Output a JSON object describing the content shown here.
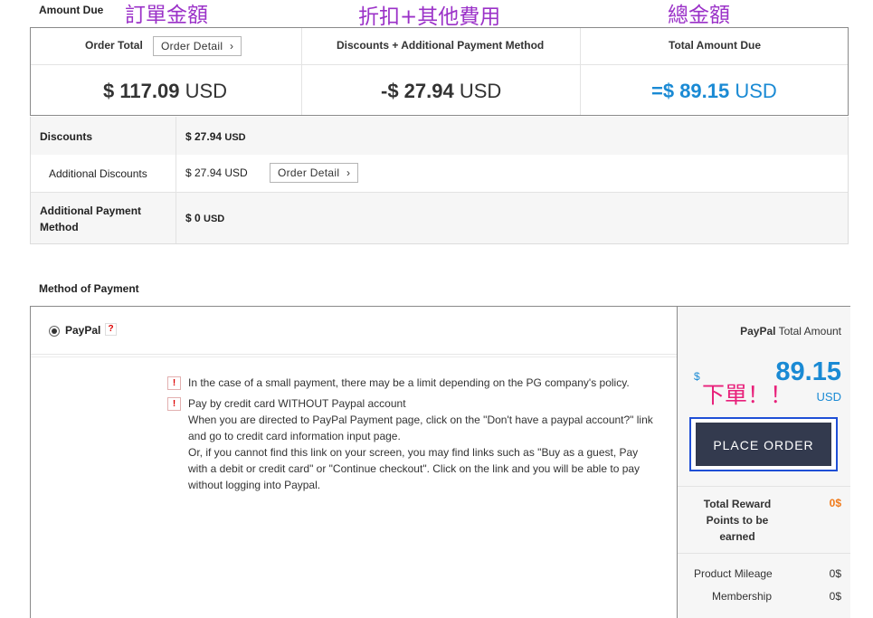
{
  "annotations": {
    "order_amount": "訂單金額",
    "discounts_fees": "折扣+其他費用",
    "total": "總金額",
    "place_order": "下單！！"
  },
  "amount_due": {
    "section_title": "Amount Due",
    "order_total_label": "Order Total",
    "order_detail_button": "Order Detail",
    "discounts_label": "Discounts + Additional Payment Method",
    "total_label": "Total Amount Due",
    "order_total_value": "$ 117.09",
    "discount_value": "-$ 27.94",
    "total_value": "=$ 89.15",
    "currency": "USD"
  },
  "breakdown": {
    "discounts_label": "Discounts",
    "discounts_value": "$ 27.94",
    "additional_discounts_label": "Additional Discounts",
    "additional_discounts_value": "$ 27.94 USD",
    "order_detail_button": "Order Detail",
    "additional_payment_label_1": "Additional Payment",
    "additional_payment_label_2": "Method",
    "additional_payment_value": "$ 0",
    "currency": "USD"
  },
  "payment": {
    "section_title": "Method of Payment",
    "method_label": "PayPal",
    "help_mark": "?",
    "warn_mark": "!",
    "note1": "In the case of a small payment, there may be a limit depending on the PG company's policy.",
    "note2_lines": [
      "Pay by credit card WITHOUT Paypal account",
      "When you are directed to PayPal Payment page, click on the \"Don't have a paypal account?\" link",
      "and go to credit card information input page.",
      "Or, if you cannot find this link on your screen, you may find links such as \"Buy as a guest, Pay",
      "with a debit or credit card\" or \"Continue checkout\". Click on the link and you will be able to pay",
      "without logging into Paypal."
    ]
  },
  "summary_side": {
    "paypal": "PayPal",
    "total_amount": "Total Amount",
    "dollar": "$",
    "amount": "89.15",
    "currency": "USD",
    "place_order_button": "PLACE ORDER",
    "reward_label_1": "Total Reward",
    "reward_label_2": "Points to be",
    "reward_label_3": "earned",
    "reward_value": "0$",
    "product_mileage_label": "Product Mileage",
    "product_mileage_value": "0$",
    "membership_label": "Membership",
    "membership_value": "0$"
  },
  "colors": {
    "accent_blue": "#1a8ad4",
    "annotation_purple": "#9b32c8",
    "annotation_pink": "#e8207a",
    "reward_orange": "#f07a1a",
    "button_dark": "#333a4e",
    "highlight_border": "#1f4fd6"
  }
}
